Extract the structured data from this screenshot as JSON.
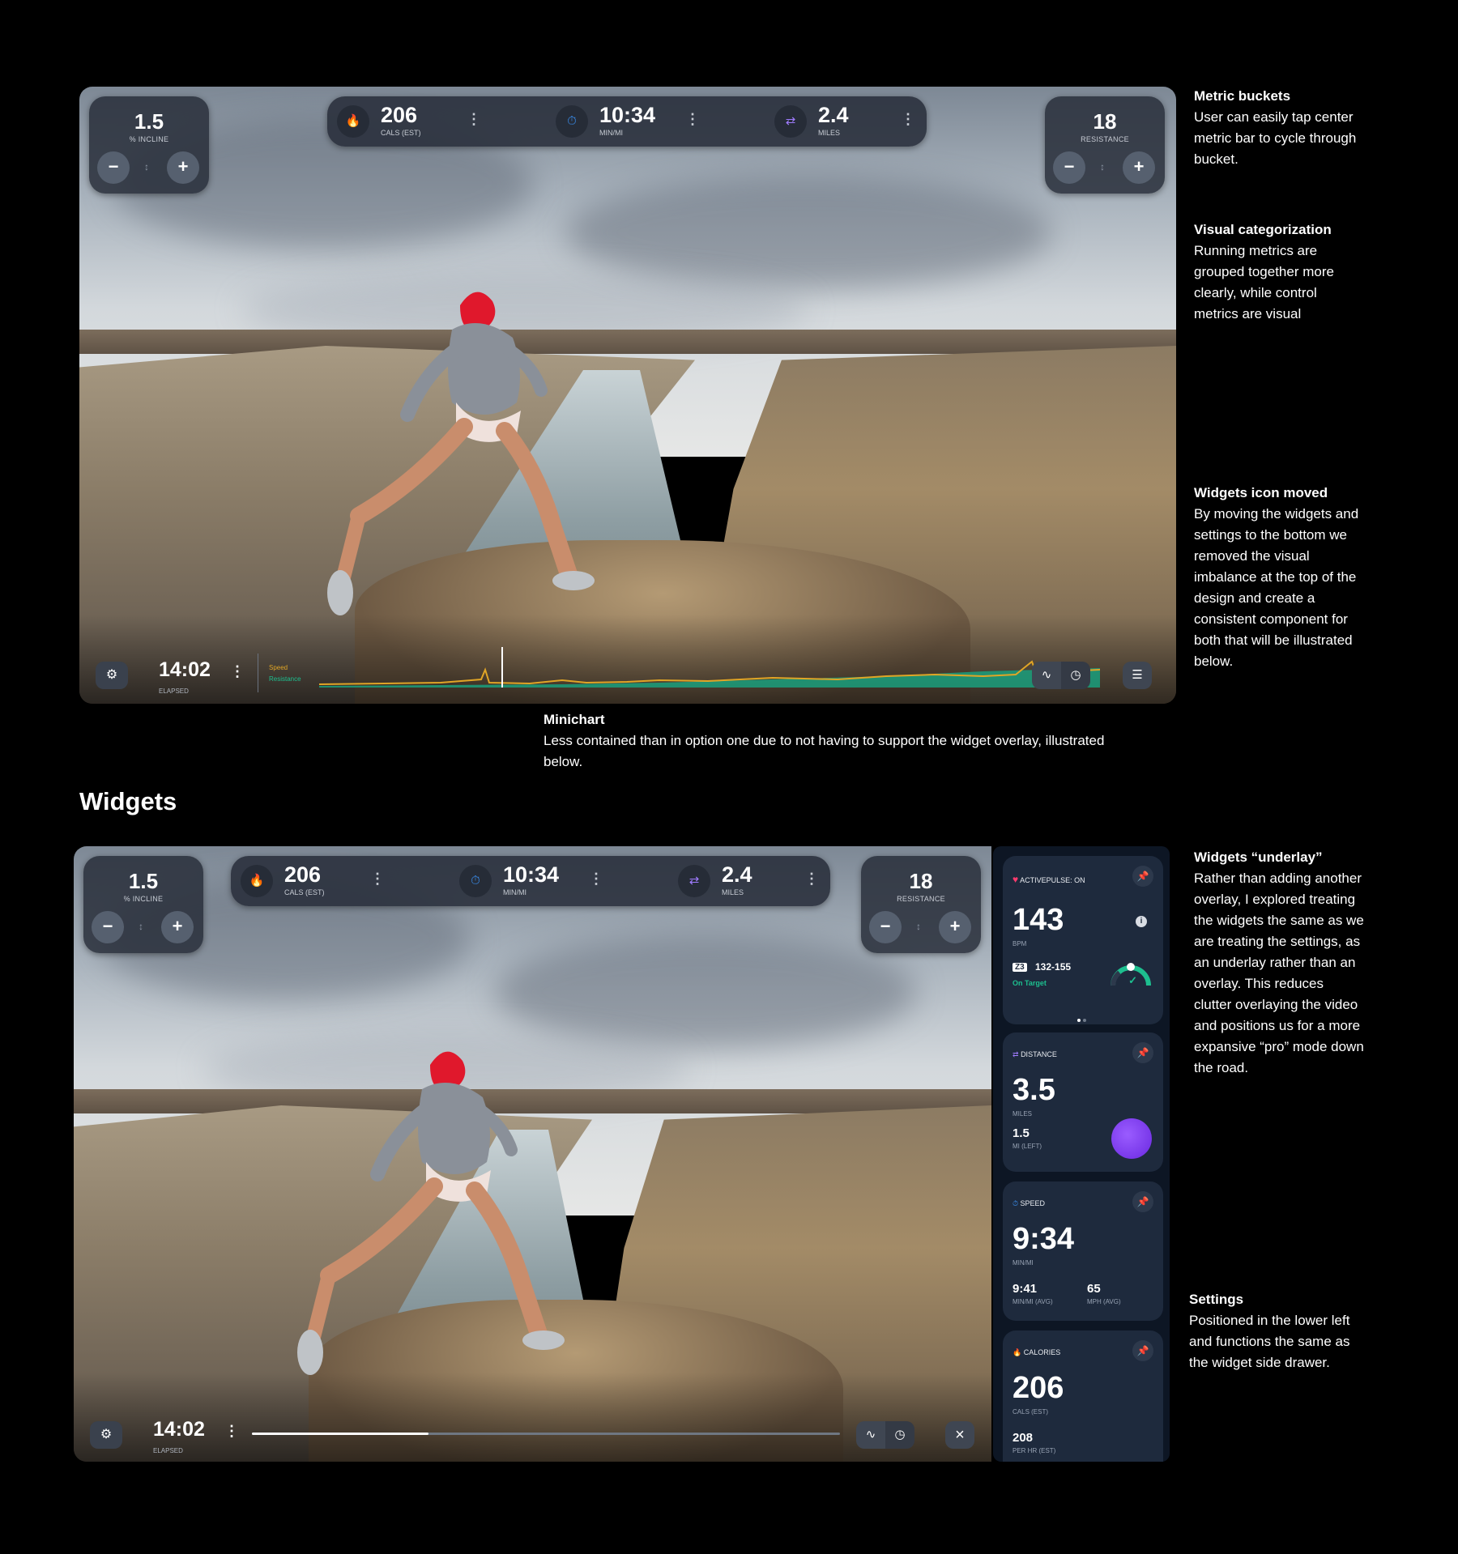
{
  "annotations": {
    "metric_buckets": {
      "title": "Metric buckets",
      "body": "User can easily tap center metric bar to cycle through bucket."
    },
    "visual_categorization": {
      "title": "Visual categorization",
      "body": "Running metrics are grouped together more clearly, while control metrics are visual"
    },
    "widgets_icon_moved": {
      "title": "Widgets icon moved",
      "body": "By moving the widgets and settings to the bottom we removed the visual imbalance at the top of the design and create a consistent component for both that will be illustrated below."
    },
    "minichart": {
      "title": "Minichart",
      "body": "Less contained than in option one due to not having to support the widget overlay, illustrated below."
    },
    "widgets_underlay": {
      "title": "Widgets “underlay”",
      "body": "Rather than adding another overlay, I explored treating the widgets the same as we are treating the settings, as an underlay rather than an overlay. This reduces clutter overlaying the video and positions us for a more expansive “pro” mode down the road."
    },
    "settings": {
      "title": "Settings",
      "body": "Positioned in the lower left and functions the same as the widget side drawer."
    }
  },
  "section_heading": "Widgets",
  "screen": {
    "incline": {
      "value": "1.5",
      "label": "% INCLINE"
    },
    "resistance": {
      "value": "18",
      "label": "RESISTANCE"
    },
    "metrics": [
      {
        "icon": "flame-icon",
        "glyph": "🔥",
        "value": "206",
        "unit": "CALS (EST)"
      },
      {
        "icon": "pace-icon",
        "glyph": "⏱",
        "value": "10:34",
        "unit": "MIN/MI"
      },
      {
        "icon": "distance-icon",
        "glyph": "⇄",
        "value": "2.4",
        "unit": "MILES"
      }
    ],
    "elapsed": {
      "time": "14:02",
      "label": "ELAPSED"
    },
    "legend": {
      "speed": "Speed",
      "resistance": "Resistance"
    },
    "minus": "−",
    "plus": "+",
    "updown": "↕",
    "more": "⋮",
    "gear": "⚙",
    "chart_glyph": "∿",
    "clock_glyph": "◷",
    "menu_glyph": "☰",
    "close_glyph": "×",
    "progress": 0.3
  },
  "drawer": {
    "activepulse": {
      "head": "ACTIVEPULSE: ON",
      "value": "143",
      "unit": "BPM",
      "zone": "Z3",
      "range": "132-155",
      "status": "On Target"
    },
    "distance": {
      "head": "DISTANCE",
      "value": "3.5",
      "unit": "MILES",
      "left_value": "1.5",
      "left_label": "MI (LEFT)"
    },
    "speed": {
      "head": "SPEED",
      "value": "9:34",
      "unit": "MIN/MI",
      "avg_pace": "9:41",
      "avg_pace_label": "MIN/MI (AVG)",
      "avg_mph": "65",
      "avg_mph_label": "MPH (AVG)"
    },
    "calories": {
      "head": "CALORIES",
      "value": "206",
      "unit": "CALS (EST)",
      "rate": "208",
      "rate_label": "PER HR (EST)"
    },
    "pin": "📌",
    "info": "i",
    "heart": "♥",
    "check": "✓"
  },
  "colors": {
    "accent_green": "#1dbf8f",
    "accent_purple": "#7b3cf0",
    "speed_line": "#e0a526",
    "flame": "#f2a529",
    "pace": "#3a8ff0",
    "distance": "#a07cff",
    "heart": "#ff3b6e"
  }
}
